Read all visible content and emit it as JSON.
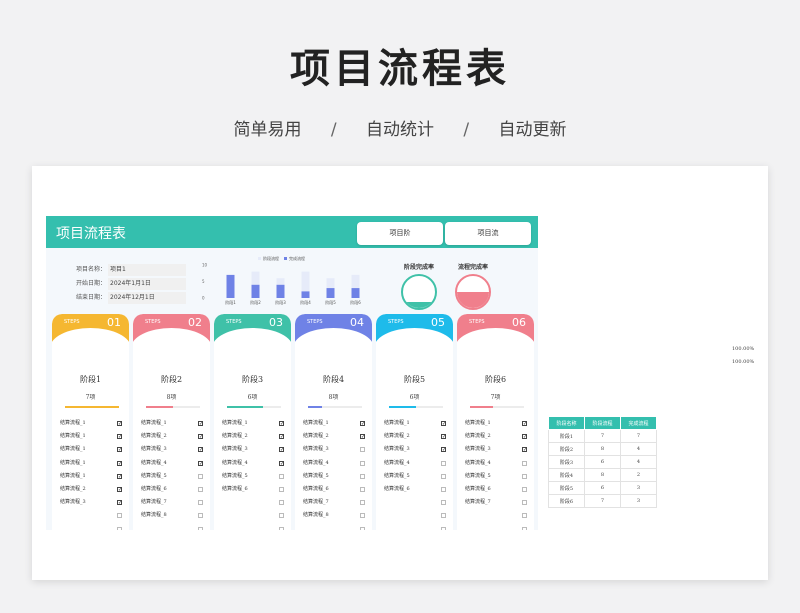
{
  "hero": {
    "title": "项目流程表",
    "features": [
      "简单易用",
      "自动统计",
      "自动更新"
    ],
    "separator": "/"
  },
  "sheet": {
    "title": "项目流程表",
    "buttons": [
      "项目阶",
      "项目流"
    ],
    "info": [
      {
        "label": "项目名称：",
        "value": "项目1"
      },
      {
        "label": "开始日期：",
        "value": "2024年1月1日"
      },
      {
        "label": "结束日期：",
        "value": "2024年12月1日"
      }
    ],
    "accent": "#34bfae"
  },
  "chart_data": {
    "type": "bar",
    "legend": [
      "阶段流程",
      "完成流程"
    ],
    "categories": [
      "阶段1",
      "阶段2",
      "阶段3",
      "阶段4",
      "阶段5",
      "阶段6"
    ],
    "series": [
      {
        "name": "阶段流程",
        "values": [
          7,
          8,
          6,
          8,
          6,
          7
        ]
      },
      {
        "name": "完成流程",
        "values": [
          7,
          4,
          4,
          2,
          3,
          3
        ]
      }
    ],
    "yticks": [
      "10",
      "5",
      "0"
    ],
    "ylim": [
      0,
      10
    ],
    "colors": [
      "#e6ebf9",
      "#6f82e6"
    ]
  },
  "gauges": [
    {
      "title": "阶段完成率",
      "value": 0.2,
      "color": "#3fc1a8"
    },
    {
      "title": "流程完成率",
      "value": 0.5,
      "color": "#f07f8c"
    }
  ],
  "stages": [
    {
      "steps": "STEPS",
      "num": "01",
      "name": "阶段1",
      "count": "7项",
      "color": "#f5b731",
      "progress": 1.0,
      "tasks": [
        [
          "结算流程_1",
          true
        ],
        [
          "结算流程_1",
          true
        ],
        [
          "结算流程_1",
          true
        ],
        [
          "结算流程_1",
          true
        ],
        [
          "结算流程_1",
          true
        ],
        [
          "结算流程_2",
          true
        ],
        [
          "结算流程_3",
          true
        ],
        [
          "",
          false
        ],
        [
          "",
          false
        ]
      ]
    },
    {
      "steps": "STEPS",
      "num": "02",
      "name": "阶段2",
      "count": "8项",
      "color": "#f07f8c",
      "progress": 0.5,
      "tasks": [
        [
          "结算流程_1",
          true
        ],
        [
          "结算流程_2",
          true
        ],
        [
          "结算流程_3",
          true
        ],
        [
          "结算流程_4",
          true
        ],
        [
          "结算流程_5",
          false
        ],
        [
          "结算流程_6",
          false
        ],
        [
          "结算流程_7",
          false
        ],
        [
          "结算流程_8",
          false
        ],
        [
          "",
          false
        ]
      ]
    },
    {
      "steps": "STEPS",
      "num": "03",
      "name": "阶段3",
      "count": "6项",
      "color": "#3fc1a8",
      "progress": 0.67,
      "tasks": [
        [
          "结算流程_1",
          true
        ],
        [
          "结算流程_2",
          true
        ],
        [
          "结算流程_3",
          true
        ],
        [
          "结算流程_4",
          true
        ],
        [
          "结算流程_5",
          false
        ],
        [
          "结算流程_6",
          false
        ],
        [
          "",
          false
        ],
        [
          "",
          false
        ],
        [
          "",
          false
        ]
      ]
    },
    {
      "steps": "STEPS",
      "num": "04",
      "name": "阶段4",
      "count": "8项",
      "color": "#6f82e6",
      "progress": 0.25,
      "tasks": [
        [
          "结算流程_1",
          true
        ],
        [
          "结算流程_2",
          true
        ],
        [
          "结算流程_3",
          false
        ],
        [
          "结算流程_4",
          false
        ],
        [
          "结算流程_5",
          false
        ],
        [
          "结算流程_6",
          false
        ],
        [
          "结算流程_7",
          false
        ],
        [
          "结算流程_8",
          false
        ],
        [
          "",
          false
        ]
      ]
    },
    {
      "steps": "STEPS",
      "num": "05",
      "name": "阶段5",
      "count": "6项",
      "color": "#1ebbea",
      "progress": 0.5,
      "tasks": [
        [
          "结算流程_1",
          true
        ],
        [
          "结算流程_2",
          true
        ],
        [
          "结算流程_3",
          true
        ],
        [
          "结算流程_4",
          false
        ],
        [
          "结算流程_5",
          false
        ],
        [
          "结算流程_6",
          false
        ],
        [
          "",
          false
        ],
        [
          "",
          false
        ],
        [
          "",
          false
        ]
      ]
    },
    {
      "steps": "STEPS",
      "num": "06",
      "name": "阶段6",
      "count": "7项",
      "color": "#f07f8c",
      "progress": 0.43,
      "tasks": [
        [
          "结算流程_1",
          true
        ],
        [
          "结算流程_2",
          true
        ],
        [
          "结算流程_3",
          true
        ],
        [
          "结算流程_4",
          false
        ],
        [
          "结算流程_5",
          false
        ],
        [
          "结算流程_6",
          false
        ],
        [
          "结算流程_7",
          false
        ],
        [
          "",
          false
        ],
        [
          "",
          false
        ]
      ]
    }
  ],
  "percentages": [
    "100.00%",
    "100.00%"
  ],
  "summary": {
    "headers": [
      "阶段名称",
      "阶段流程",
      "完成流程"
    ],
    "rows": [
      [
        "阶段1",
        "7",
        "7"
      ],
      [
        "阶段2",
        "8",
        "4"
      ],
      [
        "阶段3",
        "6",
        "4"
      ],
      [
        "阶段4",
        "8",
        "2"
      ],
      [
        "阶段5",
        "6",
        "3"
      ],
      [
        "阶段6",
        "7",
        "3"
      ]
    ]
  }
}
